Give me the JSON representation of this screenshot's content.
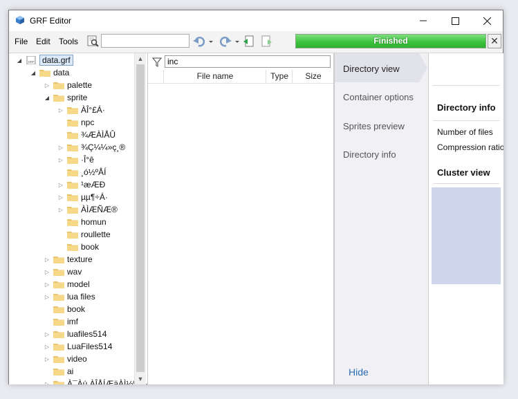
{
  "window": {
    "title": "GRF Editor",
    "app_icon": "cube-icon"
  },
  "menu": {
    "file": "File",
    "edit": "Edit",
    "tools": "Tools"
  },
  "toolbar": {
    "search_value": "",
    "icons": [
      "search-icon",
      "undo-icon",
      "redo-icon",
      "extract-icon",
      "export-icon"
    ]
  },
  "progress": {
    "label": "Finished",
    "percent": 100,
    "fill_color": "#3fc43f"
  },
  "tree": {
    "items": [
      {
        "label": "data.grf",
        "depth": 0,
        "arrow": "open",
        "icon": "grf-file-icon",
        "selected": true
      },
      {
        "label": "data",
        "depth": 1,
        "arrow": "open",
        "icon": "folder-open-icon"
      },
      {
        "label": "palette",
        "depth": 2,
        "arrow": "closed",
        "icon": "folder-icon"
      },
      {
        "label": "sprite",
        "depth": 2,
        "arrow": "open",
        "icon": "folder-open-icon"
      },
      {
        "label": "ÀÎ°£Á·",
        "depth": 3,
        "arrow": "closed",
        "icon": "folder-icon"
      },
      {
        "label": "npc",
        "depth": 3,
        "arrow": "none",
        "icon": "folder-icon"
      },
      {
        "label": "¾ÆÀÌÅÛ",
        "depth": 3,
        "arrow": "none",
        "icon": "folder-icon"
      },
      {
        "label": "¾Ç¼¼»ç¸®",
        "depth": 3,
        "arrow": "closed",
        "icon": "folder-icon"
      },
      {
        "label": "·Î°ê",
        "depth": 3,
        "arrow": "closed",
        "icon": "folder-icon"
      },
      {
        "label": "¸ó½ºÅÍ",
        "depth": 3,
        "arrow": "none",
        "icon": "folder-icon"
      },
      {
        "label": "¹æÆÐ",
        "depth": 3,
        "arrow": "closed",
        "icon": "folder-icon"
      },
      {
        "label": "µµ¶÷Á·",
        "depth": 3,
        "arrow": "closed",
        "icon": "folder-icon"
      },
      {
        "label": "ÀÌÆÑÆ®",
        "depth": 3,
        "arrow": "closed",
        "icon": "folder-icon"
      },
      {
        "label": "homun",
        "depth": 3,
        "arrow": "none",
        "icon": "folder-icon"
      },
      {
        "label": "roullette",
        "depth": 3,
        "arrow": "none",
        "icon": "folder-icon"
      },
      {
        "label": "book",
        "depth": 3,
        "arrow": "none",
        "icon": "folder-icon"
      },
      {
        "label": "texture",
        "depth": 2,
        "arrow": "closed",
        "icon": "folder-icon"
      },
      {
        "label": "wav",
        "depth": 2,
        "arrow": "closed",
        "icon": "folder-icon"
      },
      {
        "label": "model",
        "depth": 2,
        "arrow": "closed",
        "icon": "folder-icon"
      },
      {
        "label": "lua files",
        "depth": 2,
        "arrow": "closed",
        "icon": "folder-icon"
      },
      {
        "label": "book",
        "depth": 2,
        "arrow": "none",
        "icon": "folder-icon"
      },
      {
        "label": "imf",
        "depth": 2,
        "arrow": "none",
        "icon": "folder-icon"
      },
      {
        "label": "luafiles514",
        "depth": 2,
        "arrow": "closed",
        "icon": "folder-icon"
      },
      {
        "label": "LuaFiles514",
        "depth": 2,
        "arrow": "closed",
        "icon": "folder-icon"
      },
      {
        "label": "video",
        "depth": 2,
        "arrow": "closed",
        "icon": "folder-icon"
      },
      {
        "label": "ai",
        "depth": 2,
        "arrow": "none",
        "icon": "folder-icon"
      },
      {
        "label": "À¯Àú ÀÎÅÍÆäÀÌ½º",
        "depth": 2,
        "arrow": "closed",
        "icon": "folder-icon"
      }
    ]
  },
  "file_list": {
    "filter_value": "inc",
    "columns": {
      "name": "File name",
      "type": "Type",
      "size": "Size"
    }
  },
  "side_tabs": {
    "items": [
      "Directory view",
      "Container options",
      "Sprites preview",
      "Directory info"
    ],
    "active": 0,
    "hide_label": "Hide"
  },
  "info": {
    "directory_info_heading": "Directory info",
    "number_of_files_label": "Number of files",
    "compression_ratio_label": "Compression ratio",
    "cluster_view_heading": "Cluster view",
    "cluster_color": "#cdd6ea"
  }
}
